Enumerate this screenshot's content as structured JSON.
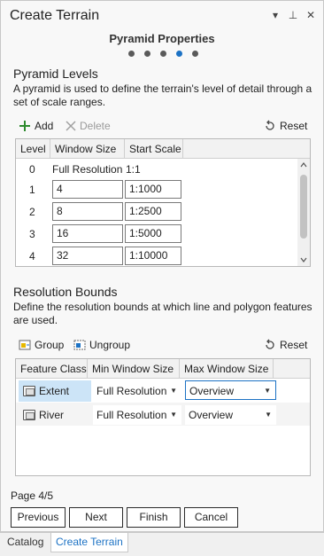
{
  "window": {
    "title": "Create Terrain",
    "menu_glyph": "▾",
    "pin_glyph": "⊥",
    "close_glyph": "✕"
  },
  "step": {
    "title": "Pyramid Properties",
    "total": 5,
    "current": 4
  },
  "pyramid": {
    "title": "Pyramid Levels",
    "description": "A pyramid is used to define the terrain's level of detail through a set of scale ranges.",
    "add_label": "Add",
    "delete_label": "Delete",
    "reset_label": "Reset",
    "columns": [
      "Level",
      "Window Size",
      "Start Scale"
    ],
    "rows": [
      {
        "level": "0",
        "window_size": "Full Resolution",
        "start_scale": "1:1"
      },
      {
        "level": "1",
        "window_size": "4",
        "start_scale": "1:1000"
      },
      {
        "level": "2",
        "window_size": "8",
        "start_scale": "1:2500"
      },
      {
        "level": "3",
        "window_size": "16",
        "start_scale": "1:5000"
      },
      {
        "level": "4",
        "window_size": "32",
        "start_scale": "1:10000"
      }
    ]
  },
  "resolution": {
    "title": "Resolution Bounds",
    "description": "Define the resolution bounds at which line and polygon features are used.",
    "group_label": "Group",
    "ungroup_label": "Ungroup",
    "reset_label": "Reset",
    "columns": [
      "Feature Class",
      "Min Window Size",
      "Max Window Size"
    ],
    "rows": [
      {
        "feature_class": "Extent",
        "min": "Full Resolution",
        "max": "Overview"
      },
      {
        "feature_class": "River",
        "min": "Full Resolution",
        "max": "Overview"
      }
    ]
  },
  "footer": {
    "page_label": "Page 4/5",
    "previous": "Previous",
    "next": "Next",
    "finish": "Finish",
    "cancel": "Cancel"
  },
  "bottom_tabs": [
    {
      "label": "Catalog"
    },
    {
      "label": "Create Terrain"
    }
  ],
  "colors": {
    "accent": "#1c72c4",
    "add_green": "#2e8b2e",
    "selected_cell": "#cce4f7"
  }
}
